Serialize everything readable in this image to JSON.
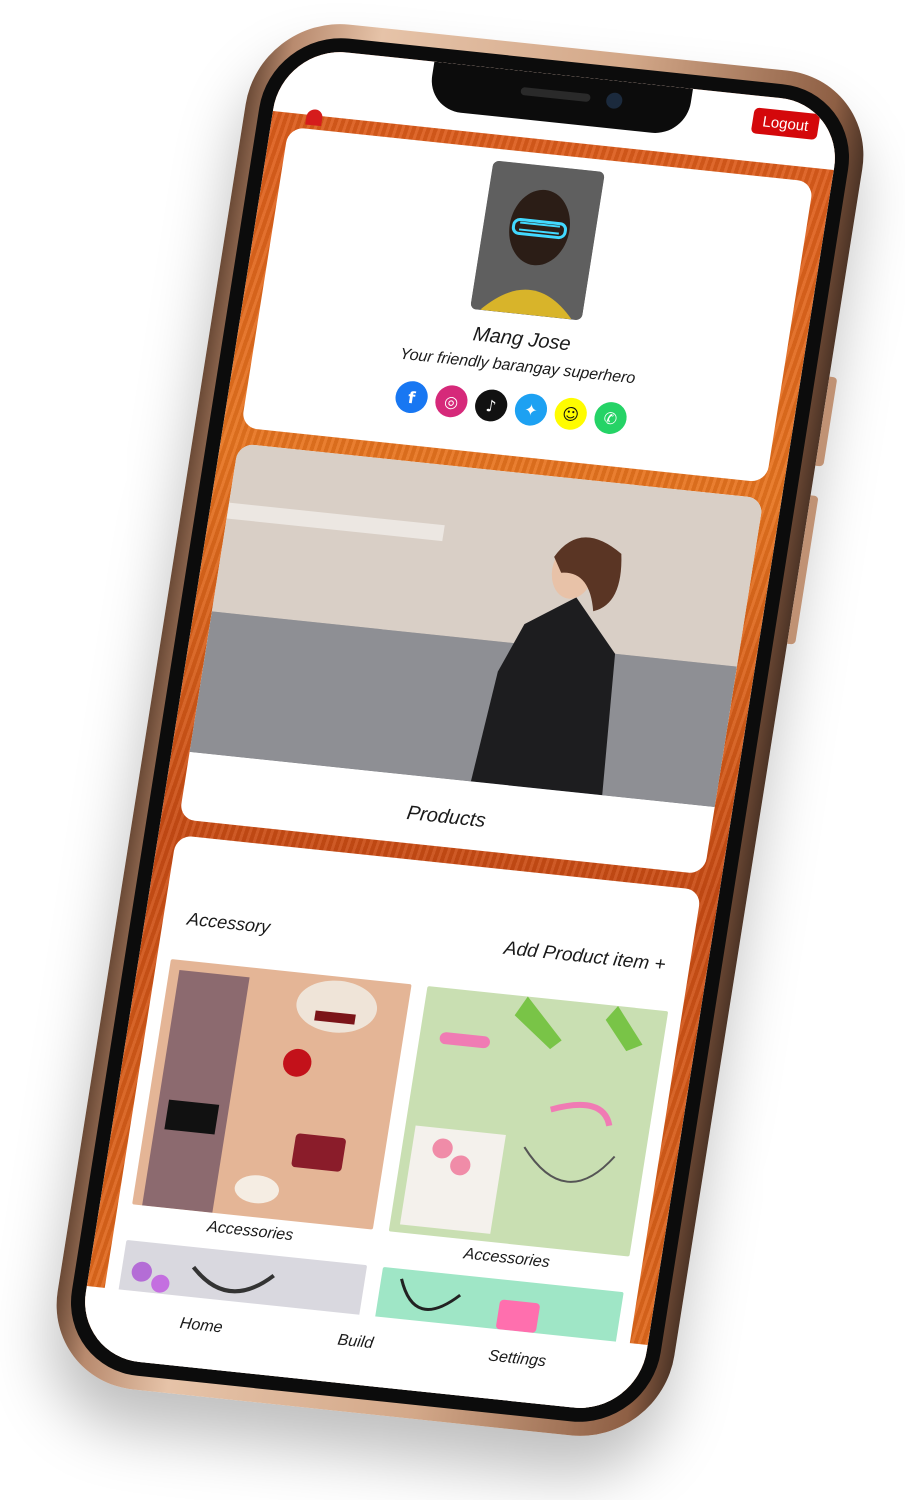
{
  "header": {
    "logout_label": "Logout"
  },
  "profile": {
    "name": "Mang Jose",
    "tagline": "Your friendly barangay superhero",
    "socials": [
      {
        "icon": "facebook-icon",
        "glyph": "f",
        "color": "#1877f2"
      },
      {
        "icon": "instagram-icon",
        "glyph": "◎",
        "color": "#d6297a"
      },
      {
        "icon": "tiktok-icon",
        "glyph": "♪",
        "color": "#111111"
      },
      {
        "icon": "twitter-icon",
        "glyph": "✦",
        "color": "#1da1f2"
      },
      {
        "icon": "snapchat-icon",
        "glyph": "☺",
        "color": "#fffc00"
      },
      {
        "icon": "whatsapp-icon",
        "glyph": "✆",
        "color": "#25d366"
      }
    ]
  },
  "hero": {
    "label": "Products"
  },
  "products": {
    "section_title": "Accessory",
    "add_item_label": "Add Product item +",
    "items": [
      {
        "label": "Accessories",
        "theme": "peach"
      },
      {
        "label": "Accessories",
        "theme": "green"
      },
      {
        "label": "",
        "theme": "grey"
      },
      {
        "label": "",
        "theme": "mint"
      }
    ]
  },
  "tabbar": {
    "items": [
      {
        "label": "Home"
      },
      {
        "label": "Build"
      },
      {
        "label": "Settings"
      }
    ]
  },
  "colors": {
    "accent_red": "#d4080b",
    "background_orange": "#e46d1d",
    "phone_gold": "#d3a889"
  }
}
